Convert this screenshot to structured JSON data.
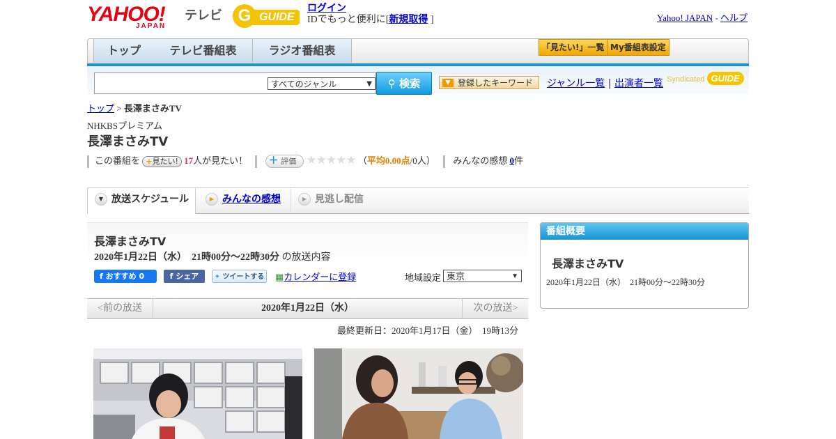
{
  "header": {
    "logo_text": "YAHOO!",
    "logo_sub": "JAPAN",
    "logo_tv": "テレビ",
    "gguide_text": "GUIDE",
    "login_link": "ログイン",
    "login_pre": "IDでもっと便利に[",
    "register_link": "新規取得",
    "login_post": "]",
    "yahoo_japan_link": "Yahoo! JAPAN",
    "dash": " - ",
    "help_link": "ヘルプ"
  },
  "nav": {
    "tabs": [
      "トップ",
      "テレビ番組表",
      "ラジオ番組表"
    ],
    "mitai_list": "「見たい!」一覧",
    "my_schedule": "My番組表設定"
  },
  "search": {
    "genre_selected": "すべてのジャンル",
    "button": "検索",
    "keyword_button": "登録したキーワード",
    "genre_list": "ジャンル一覧",
    "separator": "|",
    "performer_list": "出演者一覧",
    "syndicated": "Syndicated",
    "syndicated_logo": "GUIDE"
  },
  "breadcrumb": {
    "top": "トップ",
    "arrow": " > ",
    "current": "長澤まさみTV"
  },
  "program": {
    "station": "NHKBSプレミアム",
    "title": "長澤まさみTV",
    "stats_pre": "この番組を",
    "mitai_button": "見たい!",
    "mitai_count": "17",
    "mitai_post": "人が見たい！",
    "rating_button": "評価",
    "stars": "★★★★★",
    "rating_open": "（",
    "rating_avg": "平均0.00点",
    "rating_post": "/0人）",
    "impressions_pre": "みんなの感想 ",
    "impressions_count": "0",
    "impressions_post": "件"
  },
  "tabs": [
    {
      "label": "放送スケジュール"
    },
    {
      "label": "みんなの感想"
    },
    {
      "label": "見逃し配信"
    }
  ],
  "schedule": {
    "title": "長澤まさみTV",
    "date_bold": "2020年1月22日（水）　21時00分～22時30分",
    "date_post": "の放送内容",
    "fb_label": "おすすめ",
    "fb_count": "0",
    "share_label": "シェア",
    "tweet_label": "ツイートする",
    "calendar_link": "カレンダーに登録",
    "region_label": "地域設定",
    "region_value": "東京",
    "prev": "<前の放送",
    "current_date": "2020年1月22日（水）",
    "next": "次の放送>",
    "updated": "最終更新日：2020年1月17日（金）　19時13分"
  },
  "side": {
    "heading": "番組概要",
    "title": "長澤まさみTV",
    "date": "2020年1月22日（水）　21時00分～22時30分"
  }
}
